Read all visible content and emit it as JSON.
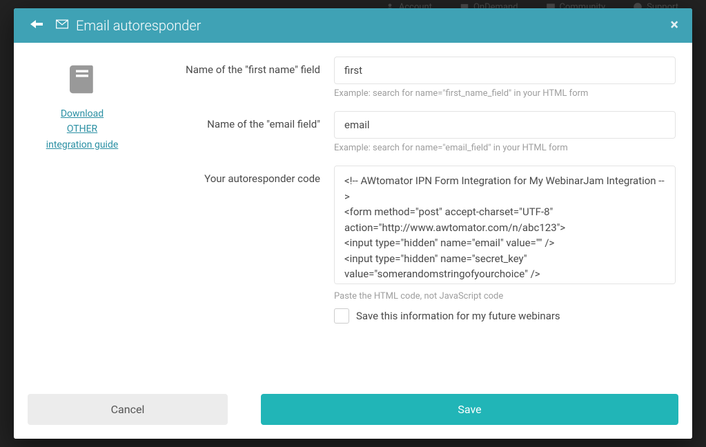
{
  "bg_nav": {
    "account": "Account",
    "ondemand": "OnDemand",
    "community": "Community",
    "support": "Support"
  },
  "modal": {
    "title": "Email autoresponder",
    "close_symbol": "×"
  },
  "sidebar": {
    "link_line1": "Download",
    "link_line2": "OTHER",
    "link_line3": "integration guide"
  },
  "fields": {
    "first_name": {
      "label": "Name of the \"first name\" field",
      "value": "first",
      "help": "Example: search for name=\"first_name_field\" in your HTML form"
    },
    "email": {
      "label": "Name of the \"email field\"",
      "value": "email",
      "help": "Example: search for name=\"email_field\" in your HTML form"
    },
    "code": {
      "label": "Your autoresponder code",
      "value": "<!-- AWtomator IPN Form Integration for My WebinarJam Integration -->\n<form method=\"post\" accept-charset=\"UTF-8\" action=\"http://www.awtomator.com/n/abc123\">\n<input type=\"hidden\" name=\"email\" value=\"\" />\n<input type=\"hidden\" name=\"secret_key\" value=\"somerandomstringofyourchoice\" />",
      "help": "Paste the HTML code, not JavaScript code"
    },
    "save_future": {
      "label": "Save this information for my future webinars"
    }
  },
  "footer": {
    "cancel": "Cancel",
    "save": "Save"
  }
}
